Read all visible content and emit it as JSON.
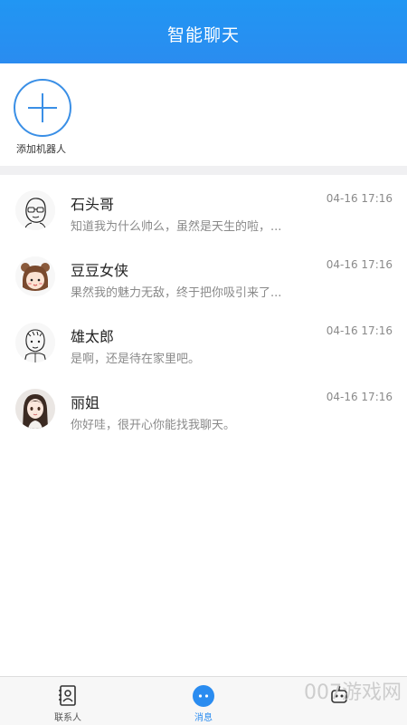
{
  "header": {
    "title": "智能聊天"
  },
  "add_robot": {
    "label": "添加机器人"
  },
  "chats": [
    {
      "name": "石头哥",
      "preview": "知道我为什么帅么，虽然是天生的啦，...",
      "time": "04-16 17:16",
      "avatar": "cartoon-boy-glasses-avatar"
    },
    {
      "name": "豆豆女侠",
      "preview": "果然我的魅力无敌，终于把你吸引来了...",
      "time": "04-16 17:16",
      "avatar": "cartoon-girl-bear-ears-avatar"
    },
    {
      "name": "雄太郎",
      "preview": "是啊，还是待在家里吧。",
      "time": "04-16 17:16",
      "avatar": "cartoon-boy-sketch-avatar"
    },
    {
      "name": "丽姐",
      "preview": "你好哇，很开心你能找我聊天。",
      "time": "04-16 17:16",
      "avatar": "anime-girl-avatar"
    }
  ],
  "tabbar": {
    "tabs": [
      {
        "label": "联系人",
        "icon": "contacts-icon"
      },
      {
        "label": "消息",
        "icon": "message-icon"
      },
      {
        "label": "",
        "icon": "robot-icon"
      }
    ],
    "active": "消息"
  },
  "watermark": "007游戏网",
  "colors": {
    "primary": "#2a8cf0",
    "divider": "#f0f0f2",
    "secondary_text": "#8a8a8a"
  }
}
